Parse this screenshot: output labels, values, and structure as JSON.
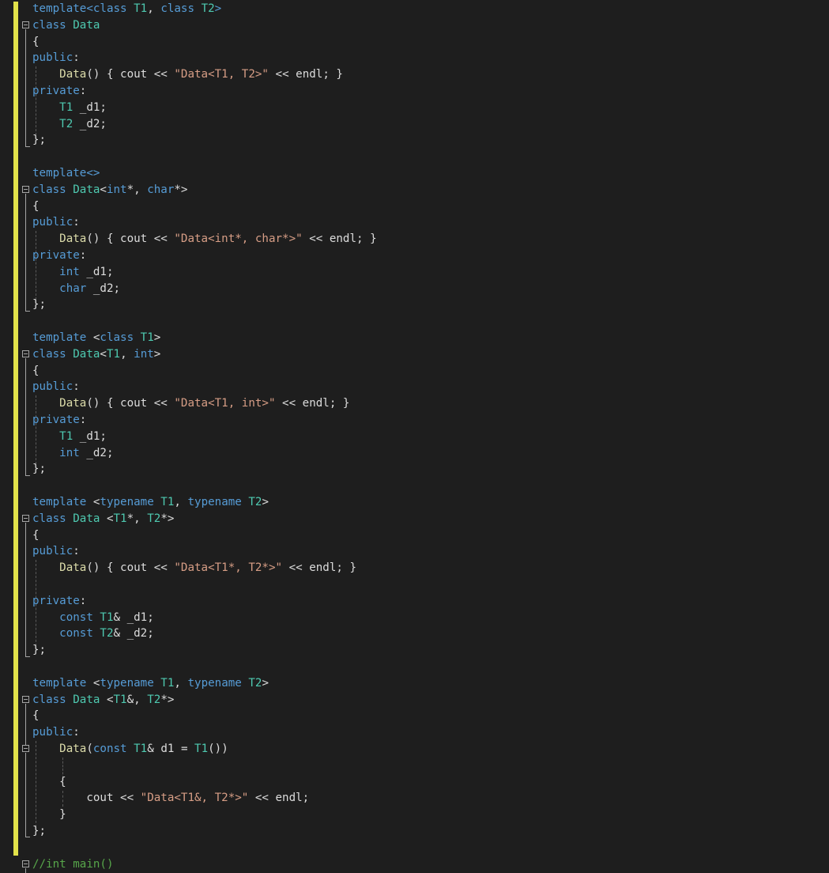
{
  "editor": {
    "lines": [
      [
        [
          "kw",
          "template<"
        ],
        [
          "kw",
          "class "
        ],
        [
          "type",
          "T1"
        ],
        [
          "txt",
          ", "
        ],
        [
          "kw",
          "class "
        ],
        [
          "type",
          "T2"
        ],
        [
          "kw",
          ">"
        ]
      ],
      [
        [
          "kw",
          "class "
        ],
        [
          "type",
          "Data"
        ]
      ],
      [
        [
          "txt",
          "{"
        ]
      ],
      [
        [
          "kw",
          "public"
        ],
        [
          "txt",
          ":"
        ]
      ],
      [
        [
          "txt",
          "    "
        ],
        [
          "fn",
          "Data"
        ],
        [
          "txt",
          "() { cout << "
        ],
        [
          "str",
          "\"Data<T1, T2>\""
        ],
        [
          "txt",
          " << endl; }"
        ]
      ],
      [
        [
          "kw",
          "private"
        ],
        [
          "txt",
          ":"
        ]
      ],
      [
        [
          "txt",
          "    "
        ],
        [
          "type",
          "T1"
        ],
        [
          "txt",
          " _d1;"
        ]
      ],
      [
        [
          "txt",
          "    "
        ],
        [
          "type",
          "T2"
        ],
        [
          "txt",
          " _d2;"
        ]
      ],
      [
        [
          "txt",
          "};"
        ]
      ],
      [],
      [
        [
          "kw",
          "template<>"
        ]
      ],
      [
        [
          "kw",
          "class "
        ],
        [
          "type",
          "Data"
        ],
        [
          "txt",
          "<"
        ],
        [
          "kw",
          "int"
        ],
        [
          "txt",
          "*, "
        ],
        [
          "kw",
          "char"
        ],
        [
          "txt",
          "*>"
        ]
      ],
      [
        [
          "txt",
          "{"
        ]
      ],
      [
        [
          "kw",
          "public"
        ],
        [
          "txt",
          ":"
        ]
      ],
      [
        [
          "txt",
          "    "
        ],
        [
          "fn",
          "Data"
        ],
        [
          "txt",
          "() { cout << "
        ],
        [
          "str",
          "\"Data<int*, char*>\""
        ],
        [
          "txt",
          " << endl; }"
        ]
      ],
      [
        [
          "kw",
          "private"
        ],
        [
          "txt",
          ":"
        ]
      ],
      [
        [
          "txt",
          "    "
        ],
        [
          "kw",
          "int"
        ],
        [
          "txt",
          " _d1;"
        ]
      ],
      [
        [
          "txt",
          "    "
        ],
        [
          "kw",
          "char"
        ],
        [
          "txt",
          " _d2;"
        ]
      ],
      [
        [
          "txt",
          "};"
        ]
      ],
      [],
      [
        [
          "kw",
          "template "
        ],
        [
          "txt",
          "<"
        ],
        [
          "kw",
          "class "
        ],
        [
          "type",
          "T1"
        ],
        [
          "txt",
          ">"
        ]
      ],
      [
        [
          "kw",
          "class "
        ],
        [
          "type",
          "Data"
        ],
        [
          "txt",
          "<"
        ],
        [
          "type",
          "T1"
        ],
        [
          "txt",
          ", "
        ],
        [
          "kw",
          "int"
        ],
        [
          "txt",
          ">"
        ]
      ],
      [
        [
          "txt",
          "{"
        ]
      ],
      [
        [
          "kw",
          "public"
        ],
        [
          "txt",
          ":"
        ]
      ],
      [
        [
          "txt",
          "    "
        ],
        [
          "fn",
          "Data"
        ],
        [
          "txt",
          "() { cout << "
        ],
        [
          "str",
          "\"Data<T1, int>\""
        ],
        [
          "txt",
          " << endl; }"
        ]
      ],
      [
        [
          "kw",
          "private"
        ],
        [
          "txt",
          ":"
        ]
      ],
      [
        [
          "txt",
          "    "
        ],
        [
          "type",
          "T1"
        ],
        [
          "txt",
          " _d1;"
        ]
      ],
      [
        [
          "txt",
          "    "
        ],
        [
          "kw",
          "int"
        ],
        [
          "txt",
          " _d2;"
        ]
      ],
      [
        [
          "txt",
          "};"
        ]
      ],
      [],
      [
        [
          "kw",
          "template "
        ],
        [
          "txt",
          "<"
        ],
        [
          "kw",
          "typename "
        ],
        [
          "type",
          "T1"
        ],
        [
          "txt",
          ", "
        ],
        [
          "kw",
          "typename "
        ],
        [
          "type",
          "T2"
        ],
        [
          "txt",
          ">"
        ]
      ],
      [
        [
          "kw",
          "class "
        ],
        [
          "type",
          "Data"
        ],
        [
          "txt",
          " <"
        ],
        [
          "type",
          "T1"
        ],
        [
          "txt",
          "*, "
        ],
        [
          "type",
          "T2"
        ],
        [
          "txt",
          "*>"
        ]
      ],
      [
        [
          "txt",
          "{"
        ]
      ],
      [
        [
          "kw",
          "public"
        ],
        [
          "txt",
          ":"
        ]
      ],
      [
        [
          "txt",
          "    "
        ],
        [
          "fn",
          "Data"
        ],
        [
          "txt",
          "() { cout << "
        ],
        [
          "str",
          "\"Data<T1*, T2*>\""
        ],
        [
          "txt",
          " << endl; }"
        ]
      ],
      [],
      [
        [
          "kw",
          "private"
        ],
        [
          "txt",
          ":"
        ]
      ],
      [
        [
          "txt",
          "    "
        ],
        [
          "kw",
          "const "
        ],
        [
          "type",
          "T1"
        ],
        [
          "txt",
          "& _d1;"
        ]
      ],
      [
        [
          "txt",
          "    "
        ],
        [
          "kw",
          "const "
        ],
        [
          "type",
          "T2"
        ],
        [
          "txt",
          "& _d2;"
        ]
      ],
      [
        [
          "txt",
          "};"
        ]
      ],
      [],
      [
        [
          "kw",
          "template "
        ],
        [
          "txt",
          "<"
        ],
        [
          "kw",
          "typename "
        ],
        [
          "type",
          "T1"
        ],
        [
          "txt",
          ", "
        ],
        [
          "kw",
          "typename "
        ],
        [
          "type",
          "T2"
        ],
        [
          "txt",
          ">"
        ]
      ],
      [
        [
          "kw",
          "class "
        ],
        [
          "type",
          "Data"
        ],
        [
          "txt",
          " <"
        ],
        [
          "type",
          "T1"
        ],
        [
          "txt",
          "&, "
        ],
        [
          "type",
          "T2"
        ],
        [
          "txt",
          "*>"
        ]
      ],
      [
        [
          "txt",
          "{"
        ]
      ],
      [
        [
          "kw",
          "public"
        ],
        [
          "txt",
          ":"
        ]
      ],
      [
        [
          "txt",
          "    "
        ],
        [
          "fn",
          "Data"
        ],
        [
          "txt",
          "("
        ],
        [
          "kw",
          "const "
        ],
        [
          "type",
          "T1"
        ],
        [
          "txt",
          "& d1 = "
        ],
        [
          "type",
          "T1"
        ],
        [
          "txt",
          "())"
        ]
      ],
      [],
      [
        [
          "txt",
          "    {"
        ]
      ],
      [
        [
          "txt",
          "        cout << "
        ],
        [
          "str",
          "\"Data<T1&, T2*>\""
        ],
        [
          "txt",
          " << endl;"
        ]
      ],
      [
        [
          "txt",
          "    }"
        ]
      ],
      [
        [
          "txt",
          "};"
        ]
      ],
      [],
      [
        [
          "cm",
          "//int main()"
        ]
      ]
    ]
  }
}
